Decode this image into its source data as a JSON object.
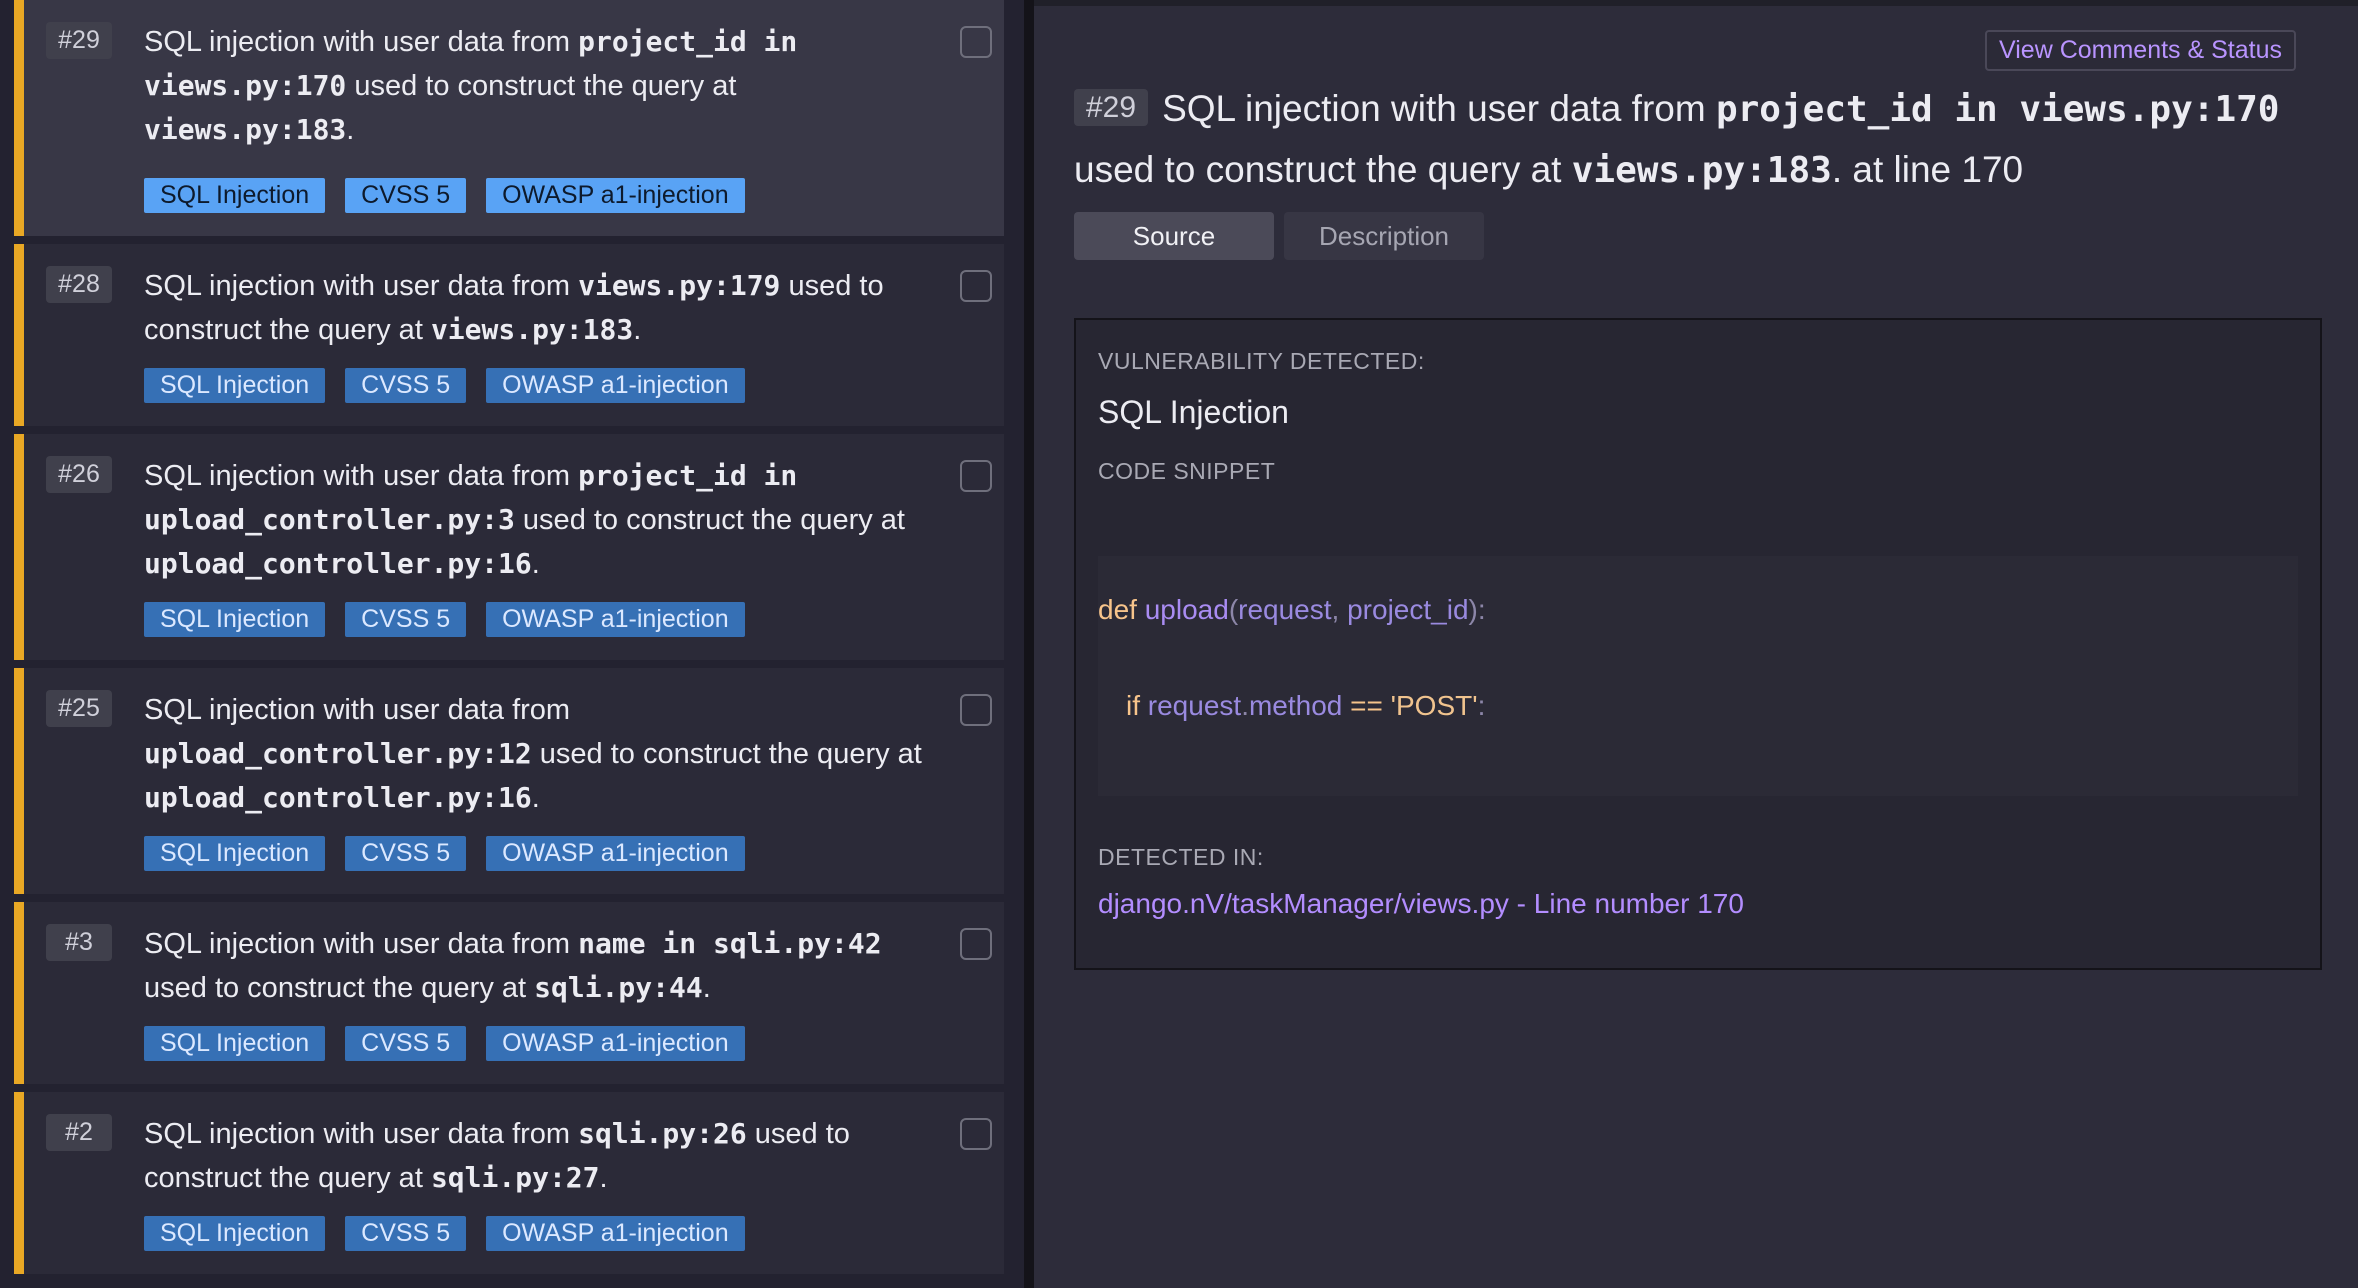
{
  "issues": [
    {
      "number": "#29",
      "selected": true,
      "title": [
        {
          "t": "SQL injection with user data from "
        },
        {
          "t": "project_id in views.py:170",
          "mono": true
        },
        {
          "t": " used to construct the query at "
        },
        {
          "t": "views.py:183",
          "mono": true
        },
        {
          "t": "."
        }
      ],
      "tags": [
        "SQL Injection",
        "CVSS 5",
        "OWASP a1-injection"
      ]
    },
    {
      "number": "#28",
      "selected": false,
      "title": [
        {
          "t": "SQL injection with user data from "
        },
        {
          "t": "views.py:179",
          "mono": true
        },
        {
          "t": " used to construct the query at "
        },
        {
          "t": "views.py:183",
          "mono": true
        },
        {
          "t": "."
        }
      ],
      "tags": [
        "SQL Injection",
        "CVSS 5",
        "OWASP a1-injection"
      ]
    },
    {
      "number": "#26",
      "selected": false,
      "title": [
        {
          "t": "SQL injection with user data from "
        },
        {
          "t": "project_id in upload_controller.py:3",
          "mono": true
        },
        {
          "t": " used to construct the query at "
        },
        {
          "t": "upload_controller.py:16",
          "mono": true
        },
        {
          "t": "."
        }
      ],
      "tags": [
        "SQL Injection",
        "CVSS 5",
        "OWASP a1-injection"
      ]
    },
    {
      "number": "#25",
      "selected": false,
      "title": [
        {
          "t": "SQL injection with user data from "
        },
        {
          "t": "upload_controller.py:12",
          "mono": true
        },
        {
          "t": " used to construct the query at "
        },
        {
          "t": "upload_controller.py:16",
          "mono": true
        },
        {
          "t": "."
        }
      ],
      "tags": [
        "SQL Injection",
        "CVSS 5",
        "OWASP a1-injection"
      ]
    },
    {
      "number": "#3",
      "selected": false,
      "title": [
        {
          "t": "SQL injection with user data from "
        },
        {
          "t": "name in sqli.py:42",
          "mono": true
        },
        {
          "t": " used to construct the query at "
        },
        {
          "t": "sqli.py:44",
          "mono": true
        },
        {
          "t": "."
        }
      ],
      "tags": [
        "SQL Injection",
        "CVSS 5",
        "OWASP a1-injection"
      ]
    },
    {
      "number": "#2",
      "selected": false,
      "title": [
        {
          "t": "SQL injection with user data from "
        },
        {
          "t": "sqli.py:26",
          "mono": true
        },
        {
          "t": " used to construct the query at "
        },
        {
          "t": "sqli.py:27",
          "mono": true
        },
        {
          "t": "."
        }
      ],
      "tags": [
        "SQL Injection",
        "CVSS 5",
        "OWASP a1-injection"
      ]
    }
  ],
  "detail": {
    "view_comments_label": "View Comments & Status",
    "number": "#29",
    "title_pre": "SQL injection with user data from ",
    "title_mono1": "project_id in views.py:170",
    "title_mid": " used to construct the query at ",
    "title_mono2": "views.py:183",
    "title_post": ". at line 170",
    "tabs": {
      "source": "Source",
      "description": "Description"
    },
    "vuln_label": "VULNERABILITY DETECTED:",
    "vuln_name": "SQL Injection",
    "code_label": "CODE SNIPPET",
    "code": {
      "l1_kw": "def",
      "l1_fn": "upload",
      "l1_open": "(",
      "l1_p1": "request",
      "l1_comma": ", ",
      "l1_p2": "project_id",
      "l1_close": "):",
      "l2_kw": "if",
      "l2_obj": "request",
      "l2_dot": ".",
      "l2_attr": "method",
      "l2_op": " == ",
      "l2_str": "'POST'",
      "l2_colon": ":"
    },
    "detected_label": "DETECTED IN:",
    "detected_path": "django.nV/taskManager/views.py - Line number 170"
  },
  "colors": {
    "accent_bar": "#e9a825",
    "tag_bg": "#3670b5",
    "tag_selected_bg": "#59a3f5",
    "link": "#b38dff"
  }
}
